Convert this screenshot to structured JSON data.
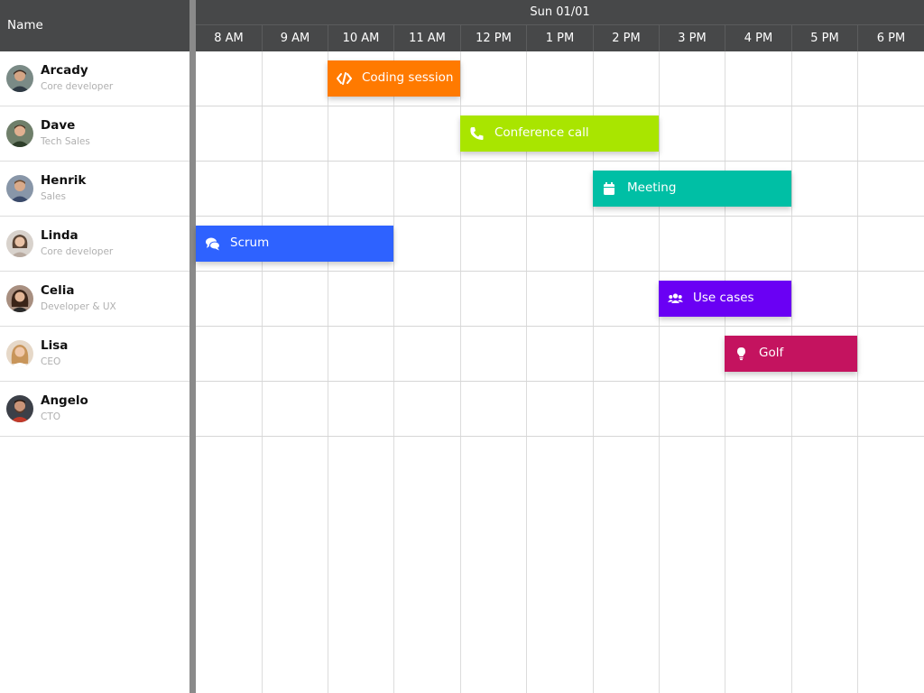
{
  "header": {
    "name_column_title": "Name",
    "date": "Sun 01/01",
    "hours": [
      "8 AM",
      "9 AM",
      "10 AM",
      "11 AM",
      "12 PM",
      "1 PM",
      "2 PM",
      "3 PM",
      "4 PM",
      "5 PM",
      "6 PM"
    ]
  },
  "resources": [
    {
      "name": "Arcady",
      "role": "Core developer"
    },
    {
      "name": "Dave",
      "role": "Tech Sales"
    },
    {
      "name": "Henrik",
      "role": "Sales"
    },
    {
      "name": "Linda",
      "role": "Core developer"
    },
    {
      "name": "Celia",
      "role": "Developer & UX"
    },
    {
      "name": "Lisa",
      "role": "CEO"
    },
    {
      "name": "Angelo",
      "role": "CTO"
    }
  ],
  "events": [
    {
      "name": "Coding session",
      "resource": "Arcady",
      "start": "10 AM",
      "end": "12 PM",
      "color": "#ff7a00",
      "icon": "code-icon"
    },
    {
      "name": "Conference call",
      "resource": "Dave",
      "start": "12 PM",
      "end": "3 PM",
      "color": "#a9e500",
      "icon": "phone-icon"
    },
    {
      "name": "Meeting",
      "resource": "Henrik",
      "start": "2 PM",
      "end": "5 PM",
      "color": "#00bfa5",
      "icon": "calendar-icon"
    },
    {
      "name": "Scrum",
      "resource": "Linda",
      "start": "8 AM",
      "end": "11 AM",
      "color": "#2e62ff",
      "icon": "comments-icon"
    },
    {
      "name": "Use cases",
      "resource": "Celia",
      "start": "3 PM",
      "end": "5 PM",
      "color": "#6a00f4",
      "icon": "users-icon"
    },
    {
      "name": "Golf",
      "resource": "Lisa",
      "start": "4 PM",
      "end": "6 PM",
      "color": "#c4135f",
      "icon": "lightbulb-icon"
    }
  ],
  "colors": {
    "header_bg": "#474849",
    "splitter": "#8a8a8a",
    "grid_line": "#dcdcdc"
  }
}
